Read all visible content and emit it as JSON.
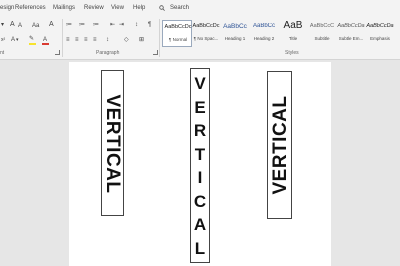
{
  "menu": {
    "tabs": [
      "esign",
      "References",
      "Mailings",
      "Review",
      "View",
      "Help"
    ],
    "search_label": "Search"
  },
  "ribbon": {
    "groups": {
      "font_end": "nt",
      "paragraph": "Paragraph",
      "styles": "Styles"
    },
    "font_row1": [
      "A",
      "A",
      "Aa",
      "A"
    ],
    "font_row2": [
      "A",
      "A"
    ],
    "paragraph_row1": [
      "≔",
      "≔",
      "≔",
      "⇤",
      "⇥",
      "↕",
      "¶"
    ],
    "paragraph_row2": [
      "≡",
      "≡",
      "≡",
      "≡",
      "↕",
      "◇",
      "⊞"
    ],
    "styles": [
      {
        "preview": "AaBbCcDc",
        "name": "¶ Normal",
        "selected": true
      },
      {
        "preview": "AaBbCcDc",
        "name": "¶ No Spac...",
        "selected": false
      },
      {
        "preview": "AaBbCc",
        "name": "Heading 1",
        "selected": false
      },
      {
        "preview": "AaBbCc",
        "name": "Heading 2",
        "selected": false
      },
      {
        "preview": "AaB",
        "name": "Title",
        "selected": false
      },
      {
        "preview": "AaBbCcC",
        "name": "Subtitle",
        "selected": false
      },
      {
        "preview": "AaBbCcDa",
        "name": "Subtle Em...",
        "selected": false
      },
      {
        "preview": "AaBbCcDa",
        "name": "Emphasis",
        "selected": false
      },
      {
        "preview": "AaBbCcDa",
        "name": "Intense",
        "selected": false
      }
    ],
    "colors": {
      "highlight": "#f7e32d",
      "font_color": "#d93a31"
    }
  },
  "document": {
    "left_text": "VERTICAL",
    "center_letters": [
      "V",
      "E",
      "R",
      "T",
      "I",
      "C",
      "A",
      "L"
    ],
    "right_text": "VERTICAL"
  }
}
